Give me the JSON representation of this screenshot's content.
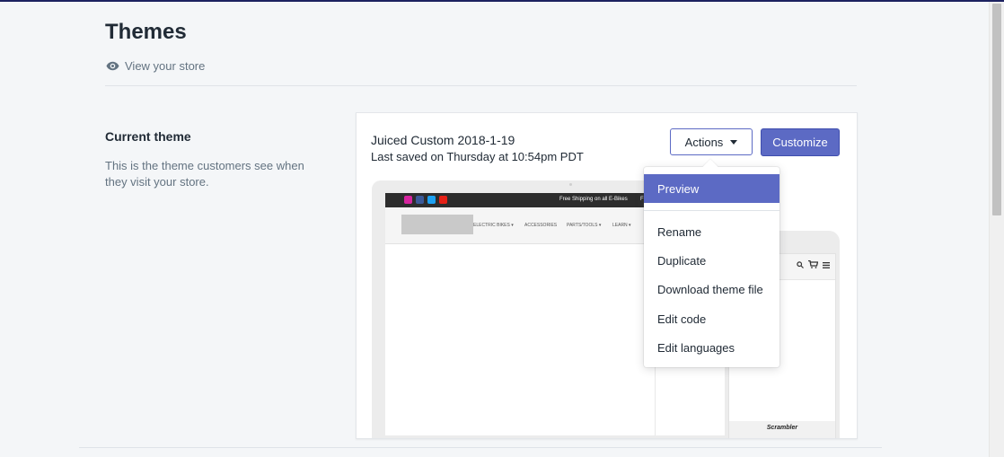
{
  "page": {
    "title": "Themes",
    "view_store_label": "View your store",
    "icons": {
      "view_store": "eye-icon"
    }
  },
  "current_theme": {
    "heading": "Current theme",
    "description": "This is the theme customers see when they visit your store."
  },
  "theme_card": {
    "name": "Juiced Custom 2018-1-19",
    "last_saved": "Last saved on Thursday at 10:54pm PDT",
    "actions_label": "Actions",
    "customize_label": "Customize"
  },
  "actions_menu": {
    "items": [
      "Preview",
      "Rename",
      "Duplicate",
      "Download theme file",
      "Edit code",
      "Edit languages"
    ],
    "highlighted": "Preview"
  },
  "preview": {
    "announcement": "Free Shipping on all E-Bikes",
    "announcement_extra": "F",
    "nav": [
      "ELECTRIC BIKES ▾",
      "ACCESSORIES",
      "PARTS/TOOLS ▾",
      "LEARN ▾"
    ],
    "mobile_label": "Scrambler"
  },
  "colors": {
    "accent": "#5c6ac4",
    "topbar": "#1c2260",
    "background": "#f4f6f8"
  }
}
